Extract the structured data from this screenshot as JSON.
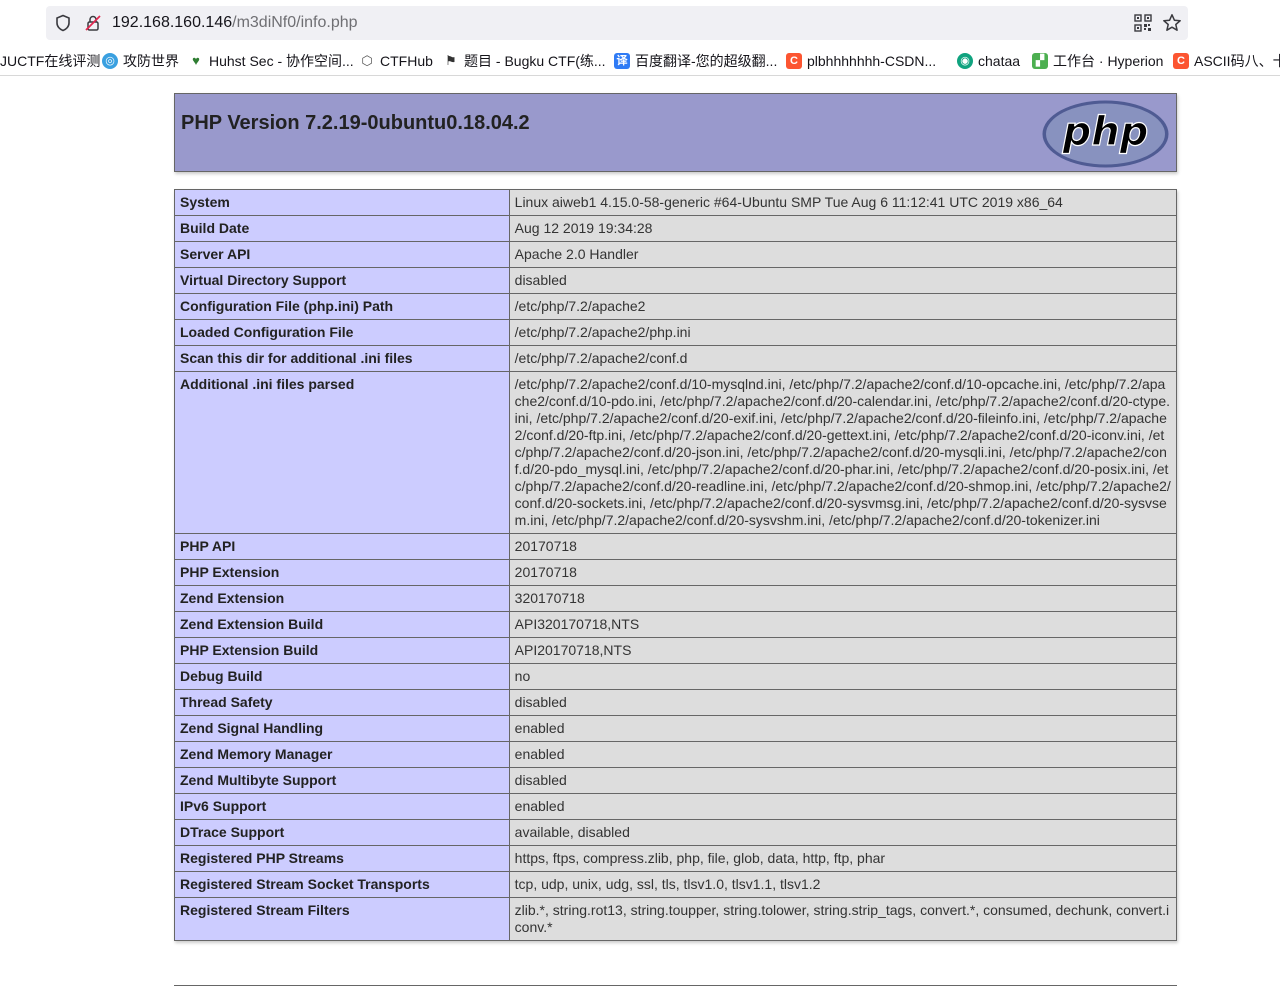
{
  "browser": {
    "url_host": "192.168.160.146",
    "url_path": "/m3diNf0/info.php",
    "bookmarks": [
      {
        "label": "JUCTF在线评测",
        "icon": "none"
      },
      {
        "label": "攻防世界",
        "icon": "globe-icon",
        "color": "#3aa0e0"
      },
      {
        "label": "Huhst Sec - 协作空间...",
        "icon": "huhst-icon",
        "color": "#2e7d32"
      },
      {
        "label": "CTFHub",
        "icon": "ctfhub-icon",
        "color": "#555555"
      },
      {
        "label": "题目 - Bugku CTF(练...",
        "icon": "flag-icon",
        "color": "#333333"
      },
      {
        "label": "百度翻译-您的超级翻...",
        "icon": "translate-icon",
        "color": "#2f7bf5"
      },
      {
        "label": "plbhhhhhhh-CSDN...",
        "icon": "csdn-icon",
        "color": "#fc5531"
      },
      {
        "label": "chataa",
        "icon": "chat-icon",
        "color": "#10a37f"
      },
      {
        "label": "工作台 · Hyperion",
        "icon": "hyperion-icon",
        "color": "#4caf50"
      },
      {
        "label": "ASCII码八、十...",
        "icon": "csdn-icon",
        "color": "#fc5531"
      }
    ]
  },
  "phpinfo": {
    "title": "PHP Version 7.2.19-0ubuntu0.18.04.2",
    "logo_text": "php",
    "rows": [
      {
        "key": "System",
        "value": "Linux aiweb1 4.15.0-58-generic #64-Ubuntu SMP Tue Aug 6 11:12:41 UTC 2019 x86_64"
      },
      {
        "key": "Build Date",
        "value": "Aug 12 2019 19:34:28"
      },
      {
        "key": "Server API",
        "value": "Apache 2.0 Handler"
      },
      {
        "key": "Virtual Directory Support",
        "value": "disabled"
      },
      {
        "key": "Configuration File (php.ini) Path",
        "value": "/etc/php/7.2/apache2"
      },
      {
        "key": "Loaded Configuration File",
        "value": "/etc/php/7.2/apache2/php.ini"
      },
      {
        "key": "Scan this dir for additional .ini files",
        "value": "/etc/php/7.2/apache2/conf.d"
      },
      {
        "key": "Additional .ini files parsed",
        "value": "/etc/php/7.2/apache2/conf.d/10-mysqlnd.ini, /etc/php/7.2/apache2/conf.d/10-opcache.ini, /etc/php/7.2/apache2/conf.d/10-pdo.ini, /etc/php/7.2/apache2/conf.d/20-calendar.ini, /etc/php/7.2/apache2/conf.d/20-ctype.ini, /etc/php/7.2/apache2/conf.d/20-exif.ini, /etc/php/7.2/apache2/conf.d/20-fileinfo.ini, /etc/php/7.2/apache2/conf.d/20-ftp.ini, /etc/php/7.2/apache2/conf.d/20-gettext.ini, /etc/php/7.2/apache2/conf.d/20-iconv.ini, /etc/php/7.2/apache2/conf.d/20-json.ini, /etc/php/7.2/apache2/conf.d/20-mysqli.ini, /etc/php/7.2/apache2/conf.d/20-pdo_mysql.ini, /etc/php/7.2/apache2/conf.d/20-phar.ini, /etc/php/7.2/apache2/conf.d/20-posix.ini, /etc/php/7.2/apache2/conf.d/20-readline.ini, /etc/php/7.2/apache2/conf.d/20-shmop.ini, /etc/php/7.2/apache2/conf.d/20-sockets.ini, /etc/php/7.2/apache2/conf.d/20-sysvmsg.ini, /etc/php/7.2/apache2/conf.d/20-sysvsem.ini, /etc/php/7.2/apache2/conf.d/20-sysvshm.ini, /etc/php/7.2/apache2/conf.d/20-tokenizer.ini"
      },
      {
        "key": "PHP API",
        "value": "20170718"
      },
      {
        "key": "PHP Extension",
        "value": "20170718"
      },
      {
        "key": "Zend Extension",
        "value": "320170718"
      },
      {
        "key": "Zend Extension Build",
        "value": "API320170718,NTS"
      },
      {
        "key": "PHP Extension Build",
        "value": "API20170718,NTS"
      },
      {
        "key": "Debug Build",
        "value": "no"
      },
      {
        "key": "Thread Safety",
        "value": "disabled"
      },
      {
        "key": "Zend Signal Handling",
        "value": "enabled"
      },
      {
        "key": "Zend Memory Manager",
        "value": "enabled"
      },
      {
        "key": "Zend Multibyte Support",
        "value": "disabled"
      },
      {
        "key": "IPv6 Support",
        "value": "enabled"
      },
      {
        "key": "DTrace Support",
        "value": "available, disabled"
      },
      {
        "key": "Registered PHP Streams",
        "value": "https, ftps, compress.zlib, php, file, glob, data, http, ftp, phar"
      },
      {
        "key": "Registered Stream Socket Transports",
        "value": "tcp, udp, unix, udg, ssl, tls, tlsv1.0, tlsv1.1, tlsv1.2"
      },
      {
        "key": "Registered Stream Filters",
        "value": "zlib.*, string.rot13, string.toupper, string.tolower, string.strip_tags, convert.*, consumed, dechunk, convert.iconv.*"
      }
    ]
  },
  "colors": {
    "header_bg": "#9999cc",
    "key_bg": "#ccccff",
    "value_bg": "#dddddd",
    "border": "#666666",
    "logo_bg": "#777bb4"
  }
}
